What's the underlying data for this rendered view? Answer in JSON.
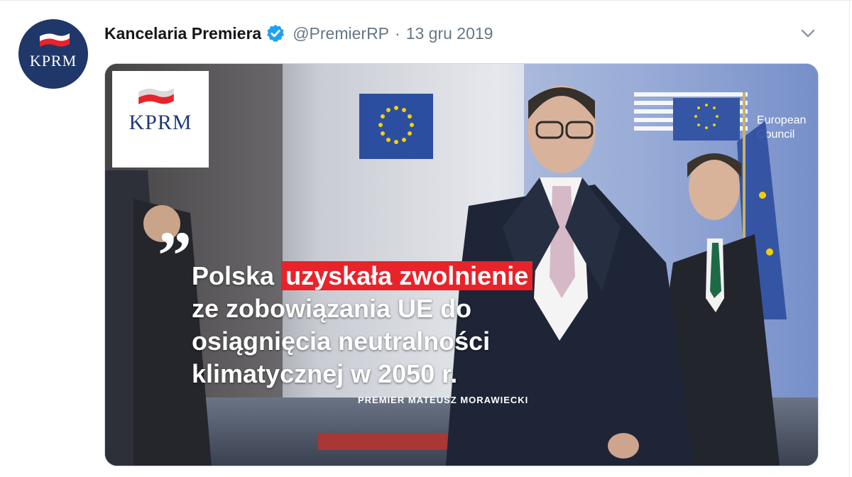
{
  "tweet": {
    "display_name": "Kancelaria Premiera",
    "handle": "@PremierRP",
    "separator": "·",
    "date": "13 gru 2019",
    "avatar_text": "KPRM"
  },
  "media": {
    "logo_text": "KPRM",
    "quote_mark": "”",
    "quote_part1": "Polska",
    "quote_highlight": "uzyskała zwolnienie",
    "quote_line2": "ze zobowiązania UE do",
    "quote_line3": "osiągnięcia neutralności",
    "quote_line4": "klimatycznej w 2050 r.",
    "attribution": "PREMIER  MATEUSZ MORAWIECKI",
    "eu_sign_text_1": "European",
    "eu_sign_text_2": "Council"
  },
  "colors": {
    "kprm_navy": "#1f3769",
    "highlight_red": "#e8232a",
    "verified_blue": "#1da1f2",
    "muted_text": "#657786",
    "eu_blue": "#2c4ea0",
    "eu_star": "#f5d000"
  },
  "icons": {
    "verified": "verified-badge-icon",
    "caret": "chevron-down-icon"
  }
}
